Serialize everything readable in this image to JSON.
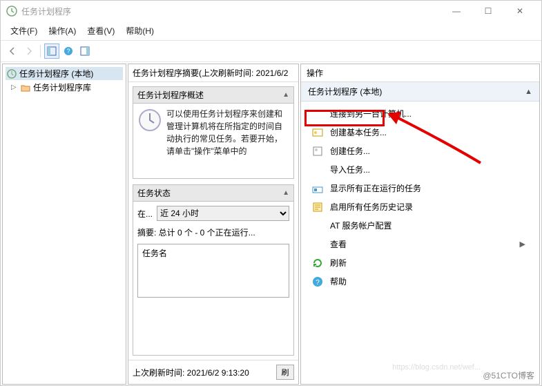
{
  "window": {
    "title": "任务计划程序",
    "min": "—",
    "max": "☐",
    "close": "✕"
  },
  "menubar": {
    "file": "文件(F)",
    "action": "操作(A)",
    "view": "查看(V)",
    "help": "帮助(H)"
  },
  "tree": {
    "root": "任务计划程序 (本地)",
    "library": "任务计划程序库"
  },
  "center": {
    "summary_title": "任务计划程序摘要(上次刷新时间: 2021/6/2",
    "overview_head": "任务计划程序概述",
    "overview_text": "可以使用任务计划程序来创建和管理计算机将在所指定的时间自动执行的常见任务。若要开始，请单击\"操作\"菜单中的",
    "status_head": "任务状态",
    "status_label": "在...",
    "status_select": "近 24 小时",
    "summary_line": "摘要: 总计 0 个 - 0 个正在运行...",
    "col_name": "任务名",
    "last_refresh": "上次刷新时间: 2021/6/2 9:13:20",
    "refresh_btn": "刷"
  },
  "right": {
    "header": "操作",
    "group": "任务计划程序 (本地)",
    "actions": {
      "connect": "连接到另一台计算机...",
      "create_basic": "创建基本任务...",
      "create_task": "创建任务...",
      "import": "导入任务...",
      "show_running": "显示所有正在运行的任务",
      "enable_history": "启用所有任务历史记录",
      "at_config": "AT 服务帐户配置",
      "view": "查看",
      "refresh": "刷新",
      "help": "帮助"
    }
  },
  "watermark": "@51CTO博客",
  "watermark2": "https://blog.csdn.net/wef..."
}
